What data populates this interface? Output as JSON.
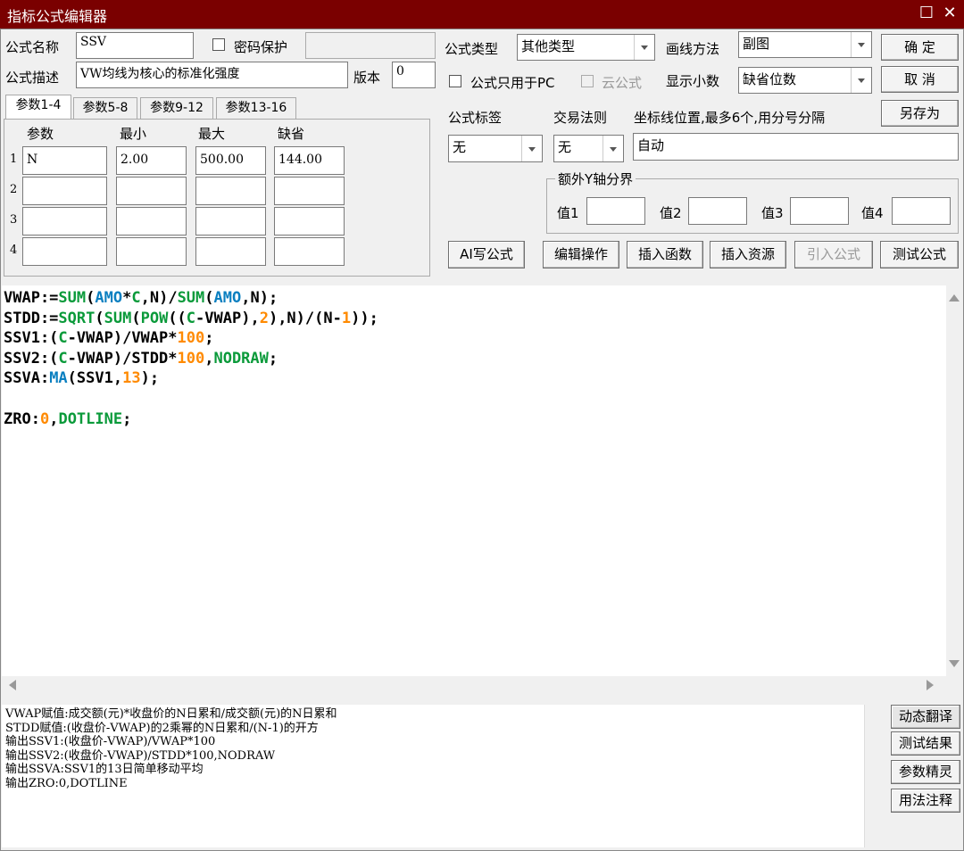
{
  "window": {
    "title": "指标公式编辑器"
  },
  "form": {
    "name_label": "公式名称",
    "name_value": "SSV",
    "password_label": "密码保护",
    "desc_label": "公式描述",
    "desc_value": "VW均线为核心的标准化强度",
    "version_label": "版本",
    "version_value": "0",
    "type_label": "公式类型",
    "type_value": "其他类型",
    "draw_label": "画线方法",
    "draw_value": "副图",
    "pc_only_label": "公式只用于PC",
    "cloud_label": "云公式",
    "decimals_label": "显示小数",
    "decimals_value": "缺省位数",
    "tag_label": "公式标签",
    "tag_value": "无",
    "trade_label": "交易法则",
    "trade_value": "无",
    "coord_label": "坐标线位置,最多6个,用分号分隔",
    "coord_value": "自动",
    "yaxis_group": "额外Y轴分界",
    "y1": "值1",
    "y2": "值2",
    "y3": "值3",
    "y4": "值4"
  },
  "buttons": {
    "ok": "确  定",
    "cancel": "取  消",
    "save_as": "另存为",
    "ai": "AI写公式",
    "edit_ops": "编辑操作",
    "insert_func": "插入函数",
    "insert_res": "插入资源",
    "import": "引入公式",
    "test": "测试公式",
    "dyn_translate": "动态翻译",
    "test_result": "测试结果",
    "param_wizard": "参数精灵",
    "usage": "用法注释"
  },
  "tabs": [
    "参数1-4",
    "参数5-8",
    "参数9-12",
    "参数13-16"
  ],
  "params": {
    "headers": [
      "参数",
      "最小",
      "最大",
      "缺省"
    ],
    "rows": [
      {
        "idx": "1",
        "name": "N",
        "min": "2.00",
        "max": "500.00",
        "def": "144.00"
      },
      {
        "idx": "2",
        "name": "",
        "min": "",
        "max": "",
        "def": ""
      },
      {
        "idx": "3",
        "name": "",
        "min": "",
        "max": "",
        "def": ""
      },
      {
        "idx": "4",
        "name": "",
        "min": "",
        "max": "",
        "def": ""
      }
    ]
  },
  "code": [
    [
      [
        "k",
        "VWAP:="
      ],
      [
        "f",
        "SUM"
      ],
      [
        "k",
        "("
      ],
      [
        "v",
        "AMO"
      ],
      [
        "k",
        "*"
      ],
      [
        "f",
        "C"
      ],
      [
        "k",
        ",N)/"
      ],
      [
        "f",
        "SUM"
      ],
      [
        "k",
        "("
      ],
      [
        "v",
        "AMO"
      ],
      [
        "k",
        ",N);"
      ]
    ],
    [
      [
        "k",
        "STDD:="
      ],
      [
        "f",
        "SQRT"
      ],
      [
        "k",
        "("
      ],
      [
        "f",
        "SUM"
      ],
      [
        "k",
        "("
      ],
      [
        "f",
        "POW"
      ],
      [
        "k",
        "(("
      ],
      [
        "f",
        "C"
      ],
      [
        "k",
        "-VWAP),"
      ],
      [
        "n",
        "2"
      ],
      [
        "k",
        "),N)/(N-"
      ],
      [
        "n",
        "1"
      ],
      [
        "k",
        "));"
      ]
    ],
    [
      [
        "k",
        "SSV1:("
      ],
      [
        "f",
        "C"
      ],
      [
        "k",
        "-VWAP)/VWAP*"
      ],
      [
        "n",
        "100"
      ],
      [
        "k",
        ";"
      ]
    ],
    [
      [
        "k",
        "SSV2:("
      ],
      [
        "f",
        "C"
      ],
      [
        "k",
        "-VWAP)/STDD*"
      ],
      [
        "n",
        "100"
      ],
      [
        "k",
        ","
      ],
      [
        "f",
        "NODRAW"
      ],
      [
        "k",
        ";"
      ]
    ],
    [
      [
        "k",
        "SSVA:"
      ],
      [
        "v",
        "MA"
      ],
      [
        "k",
        "(SSV1,"
      ],
      [
        "n",
        "13"
      ],
      [
        "k",
        ");"
      ]
    ],
    [],
    [
      [
        "k",
        "ZRO:"
      ],
      [
        "n",
        "0"
      ],
      [
        "k",
        ","
      ],
      [
        "f",
        "DOTLINE"
      ],
      [
        "k",
        ";"
      ]
    ]
  ],
  "output_lines": [
    "VWAP赋值:成交额(元)*收盘价的N日累和/成交额(元)的N日累和",
    "STDD赋值:(收盘价-VWAP)的2乘幂的N日累和/(N-1)的开方",
    "输出SSV1:(收盘价-VWAP)/VWAP*100",
    "输出SSV2:(收盘价-VWAP)/STDD*100,NODRAW",
    "输出SSVA:SSV1的13日简单移动平均",
    "输出ZRO:0,DOTLINE"
  ],
  "colors": {
    "titlebar": "#7a0000",
    "func": "#0a9a3a",
    "var": "#0a7fc0",
    "num": "#ff8a00"
  }
}
